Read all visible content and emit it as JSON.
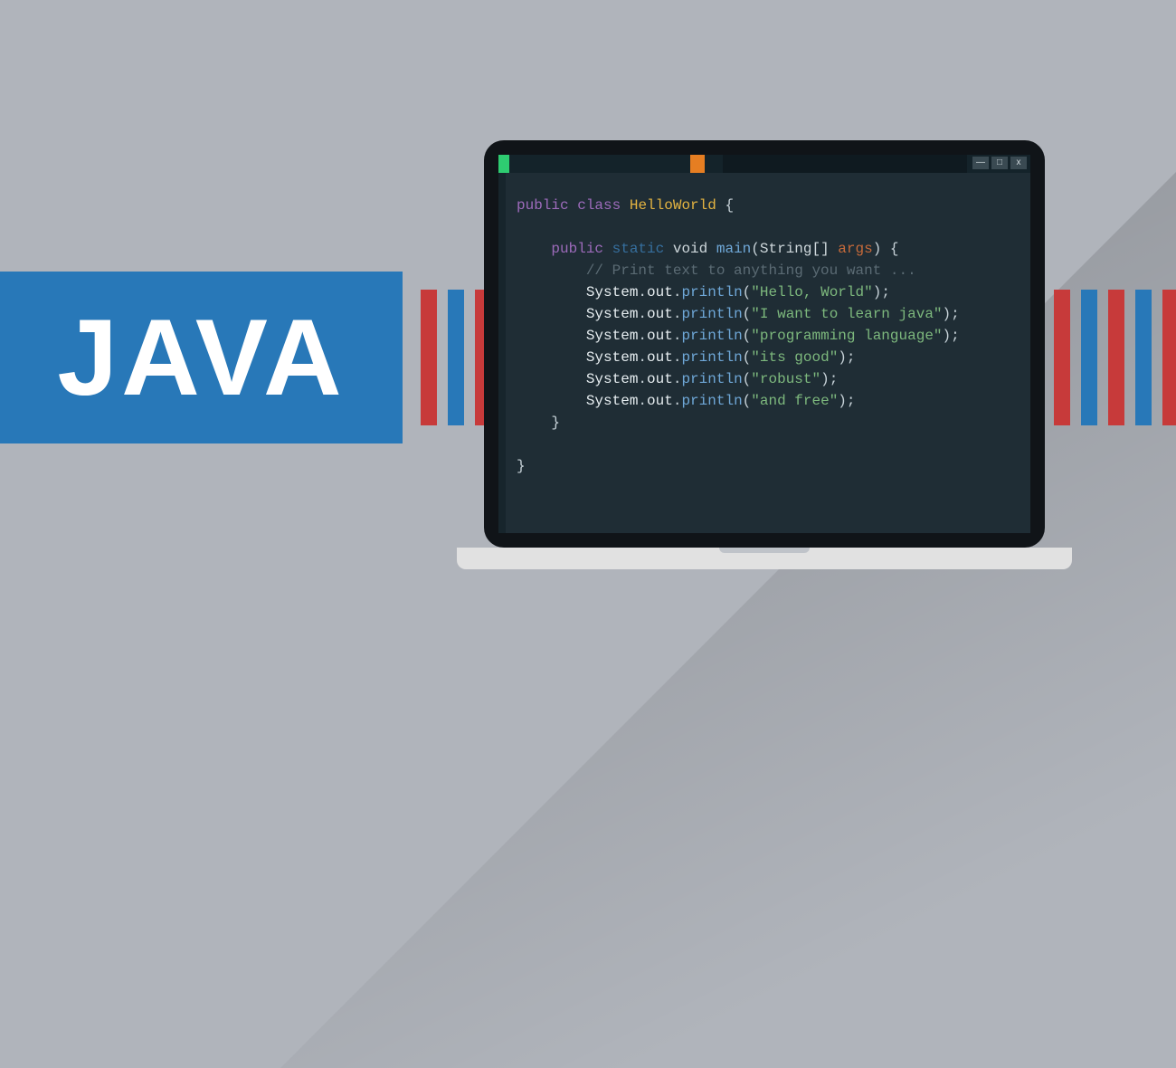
{
  "banner": {
    "title": "JAVA"
  },
  "window": {
    "min_label": "—",
    "max_label": "□",
    "close_label": "x"
  },
  "code": {
    "kw_public_1": "public",
    "kw_class": "class",
    "class_name": "HelloWorld",
    "brace_open_1": "{",
    "kw_public_2": "public",
    "kw_static": "static",
    "kw_void": "void",
    "fn_main": "main",
    "paren_open_1": "(",
    "type_string_arr": "String[]",
    "arg_name": "args",
    "paren_close_1": ")",
    "brace_open_2": "{",
    "comment": "// Print text to anything you want ...",
    "sys": "System",
    "dot": ".",
    "out": "out",
    "println": "println",
    "paren_open_c": "(",
    "paren_close_c": ")",
    "semicolon": ";",
    "strings": [
      "\"Hello, World\"",
      "\"I want to learn java\"",
      "\"programming language\"",
      "\"its good\"",
      "\"robust\"",
      "\"and free\""
    ],
    "brace_close_2": "}",
    "brace_close_1": "}"
  },
  "colors": {
    "page_bg": "#b0b4bb",
    "banner_bg": "#2878b8",
    "stripe_red": "#c73a3a",
    "stripe_blue": "#2878b8",
    "editor_bg": "#1f2d35"
  }
}
